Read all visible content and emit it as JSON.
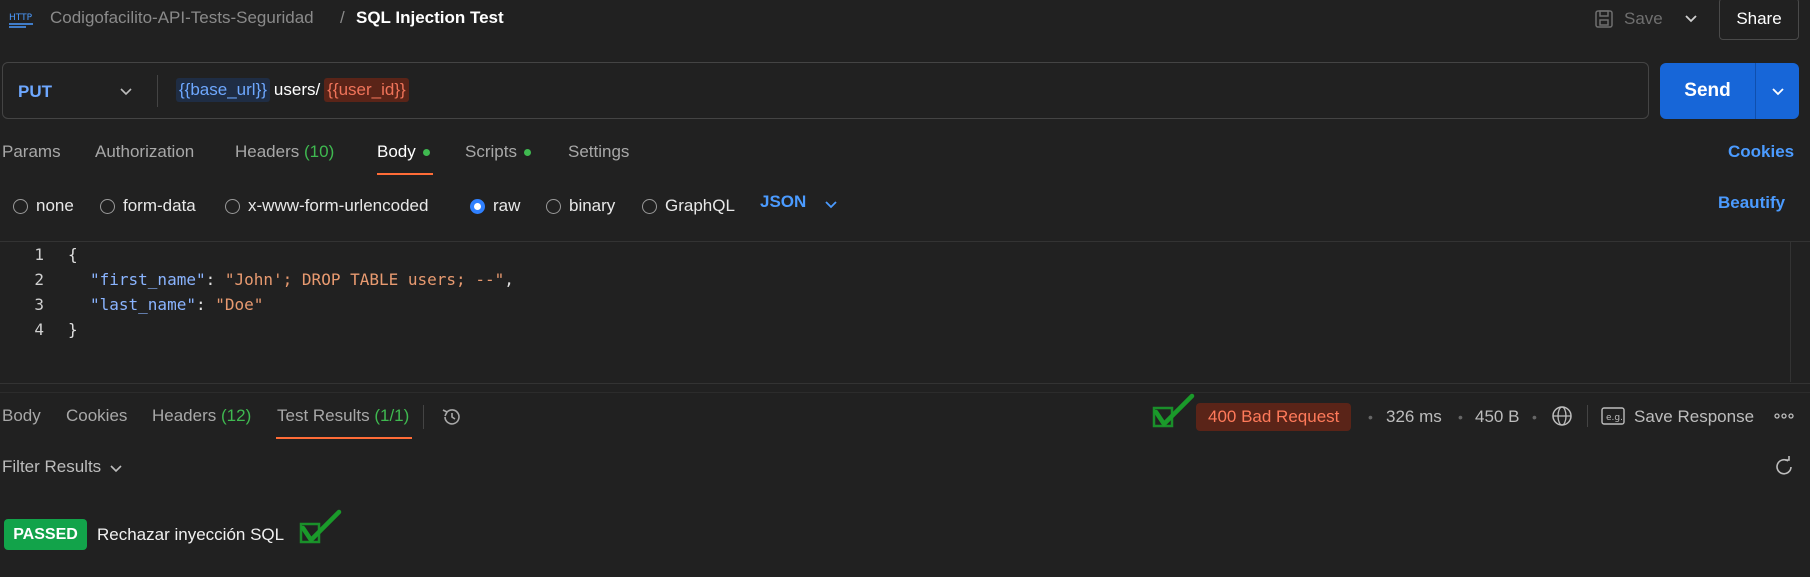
{
  "header": {
    "collection": "Codigofacilito-API-Tests-Seguridad",
    "separator": "/",
    "title": "SQL Injection Test",
    "save_label": "Save",
    "share_label": "Share",
    "http_icon": "http-icon"
  },
  "request": {
    "method": "PUT",
    "url_var1": "{{base_url}}",
    "url_path": "users/",
    "url_var2": "{{user_id}}",
    "send_label": "Send"
  },
  "request_tabs": {
    "params": "Params",
    "authorization": "Authorization",
    "headers": "Headers",
    "headers_count": "(10)",
    "body": "Body",
    "scripts": "Scripts",
    "settings": "Settings",
    "cookies": "Cookies"
  },
  "body_types": {
    "none": "none",
    "form_data": "form-data",
    "urlencoded": "x-www-form-urlencoded",
    "raw": "raw",
    "binary": "binary",
    "graphql": "GraphQL",
    "selected": "raw",
    "format": "JSON",
    "beautify": "Beautify"
  },
  "editor": {
    "lines": [
      {
        "n": "1",
        "text": "{"
      },
      {
        "n": "2",
        "key": "\"first_name\"",
        "colon": ": ",
        "value": "\"John'; DROP TABLE users; --\"",
        "tail": ","
      },
      {
        "n": "3",
        "key": "\"last_name\"",
        "colon": ": ",
        "value": "\"Doe\"",
        "tail": ""
      },
      {
        "n": "4",
        "text": "}"
      }
    ]
  },
  "response_tabs": {
    "body": "Body",
    "cookies": "Cookies",
    "headers": "Headers",
    "headers_count": "(12)",
    "test_results": "Test Results",
    "test_count": "(1/1)"
  },
  "response_meta": {
    "status": "400 Bad Request",
    "time": "326 ms",
    "size": "450 B",
    "save_response": "Save Response",
    "dot": "•"
  },
  "results": {
    "filter_label": "Filter Results",
    "badge": "PASSED",
    "test_name": "Rechazar inyección SQL"
  },
  "colors": {
    "accent_orange": "#ff6c37",
    "send_blue": "#1766d8",
    "pass_green": "#12a34a",
    "error_red": "#5a2418"
  }
}
